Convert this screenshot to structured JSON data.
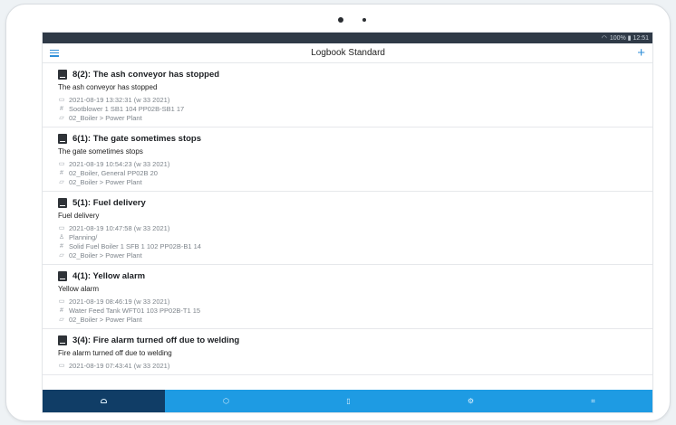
{
  "status": {
    "text": "100% ▮ 12:51"
  },
  "header": {
    "title": "Logbook Standard",
    "add_symbol": "+"
  },
  "entries": [
    {
      "title": "8(2): The ash conveyor has stopped",
      "description": "The ash conveyor has stopped",
      "date": "2021-08-19 13:32:31 (w 33 2021)",
      "tag": "Sootblower 1 SB1 104 PP02B-SB1 17",
      "folder": "02_Boiler > Power Plant"
    },
    {
      "title": "6(1): The gate sometimes stops",
      "description": "The gate sometimes stops",
      "date": "2021-08-19 10:54:23 (w 33 2021)",
      "tag": "02_Boiler, General PP02B 20",
      "folder": "02_Boiler > Power Plant"
    },
    {
      "title": "5(1): Fuel delivery",
      "description": "Fuel delivery",
      "date": "2021-08-19 10:47:58 (w 33 2021)",
      "person": "Planning/",
      "tag": "Solid Fuel Boiler 1 SFB 1 102 PP02B-B1 14",
      "folder": "02_Boiler > Power Plant"
    },
    {
      "title": "4(1): Yellow alarm",
      "description": "Yellow alarm",
      "date": "2021-08-19 08:46:19 (w 33 2021)",
      "tag": "Water Feed Tank WFT01 103 PP02B-T1 15",
      "folder": "02_Boiler > Power Plant"
    },
    {
      "title": "3(4): Fire alarm turned off due to welding",
      "description": "Fire alarm turned off due to welding",
      "date": "2021-08-19 07:43:41 (w 33 2021)"
    }
  ],
  "nav": [
    "home-icon",
    "box-icon",
    "document-icon",
    "settings-icon",
    "scan-icon"
  ],
  "colors": {
    "accent": "#1e9be3",
    "active_tab": "#103d66",
    "status_bar": "#2f3a47"
  }
}
